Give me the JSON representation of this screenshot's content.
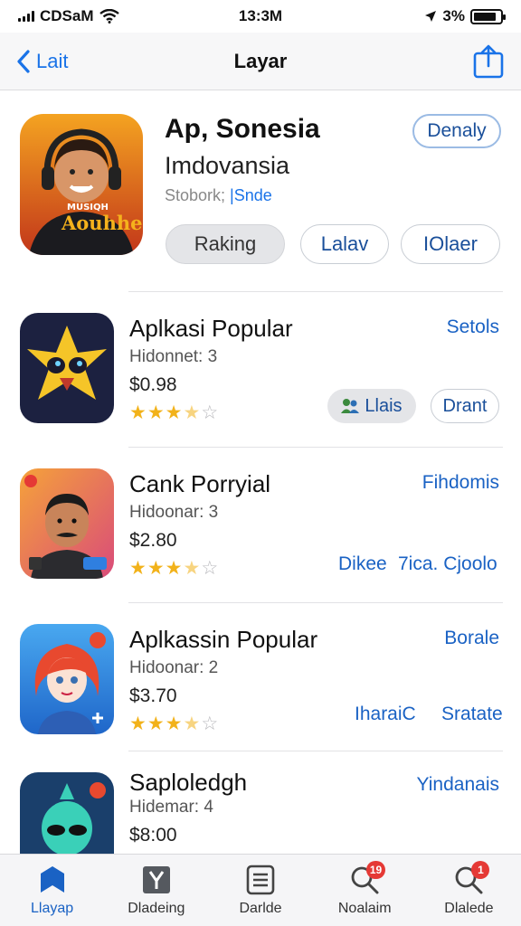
{
  "status_bar": {
    "carrier": "CDSaM",
    "time": "13:3M",
    "battery_text": "3%",
    "battery_level": 0.85
  },
  "nav": {
    "back_label": "Lait",
    "title": "Layar"
  },
  "featured": {
    "title": "Ap, Sonesia",
    "subtitle": "Imdovansia",
    "meta_prefix": "Stobork; ",
    "meta_accent": "|Snde",
    "icon_text_top": "MUSIQH",
    "icon_text_main": "Aouhhe",
    "get_button": "Denaly",
    "ranking_button": "Raking",
    "chip_1": "Lalav",
    "chip_2": "IOlaer",
    "colors": {
      "icon_bg_top": "#f4a321",
      "icon_bg_bottom": "#c2361a"
    }
  },
  "apps": [
    {
      "name": "Aplkasi Popular",
      "developer": "Hidonnet: 3",
      "price": "$0.98",
      "rating": 3.5,
      "right_link": "Setols",
      "action_chip": "Llais",
      "action_button": "Drant",
      "colors": {
        "bg": "#1c2140",
        "accent": "#f5c528"
      }
    },
    {
      "name": "Cank Porryial",
      "developer": "Hidoonar: 3",
      "price": "$2.80",
      "rating": 3.5,
      "right_link": "Fihdomis",
      "action_1": "Dikee",
      "action_2": "7ica. Cjoolo",
      "colors": {
        "bg": "#f08a28",
        "accent": "#d94b7a"
      }
    },
    {
      "name": "Aplkassin Popular",
      "developer": "Hidoonar: 2",
      "price": "$3.70",
      "rating": 3.5,
      "right_link": "Borale",
      "action_1": "IharaiC",
      "action_2": "Sratate",
      "colors": {
        "bg": "#2a7fdc",
        "accent": "#e8492f"
      }
    },
    {
      "name": "Saploledgh",
      "developer": "Hidemar: 4",
      "price": "$8:00",
      "right_link": "Yindanais",
      "colors": {
        "bg": "#1a3f6b",
        "accent": "#3ad0b8"
      }
    }
  ],
  "tabs": [
    {
      "label": "Llayap",
      "icon": "shield-icon",
      "active": true
    },
    {
      "label": "Dladeing",
      "icon": "y-box-icon"
    },
    {
      "label": "Darlde",
      "icon": "list-icon"
    },
    {
      "label": "Noalaim",
      "icon": "search-icon",
      "badge": "19"
    },
    {
      "label": "Dlalede",
      "icon": "search-icon",
      "badge": "1"
    }
  ]
}
